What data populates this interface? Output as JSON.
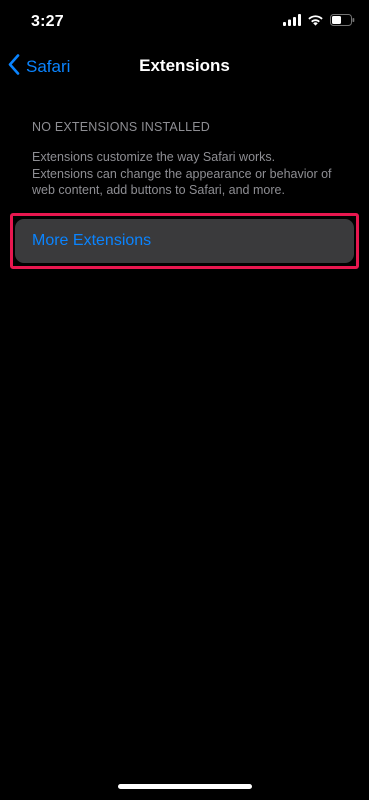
{
  "status_bar": {
    "time": "3:27"
  },
  "nav": {
    "back_label": "Safari",
    "title": "Extensions"
  },
  "section": {
    "header": "NO EXTENSIONS INSTALLED",
    "description": "Extensions customize the way Safari works. Extensions can change the appearance or behavior of web content, add buttons to Safari, and more."
  },
  "more_extensions": {
    "label": "More Extensions"
  },
  "colors": {
    "background": "#000000",
    "accent": "#0a84ff",
    "cell_background": "#3a3a3c",
    "secondary_text": "#8e8e93",
    "highlight_frame": "#e8174f"
  },
  "icons": {
    "back": "chevron-left-icon",
    "signal": "cellular-signal-icon",
    "wifi": "wifi-icon",
    "battery": "battery-icon"
  }
}
